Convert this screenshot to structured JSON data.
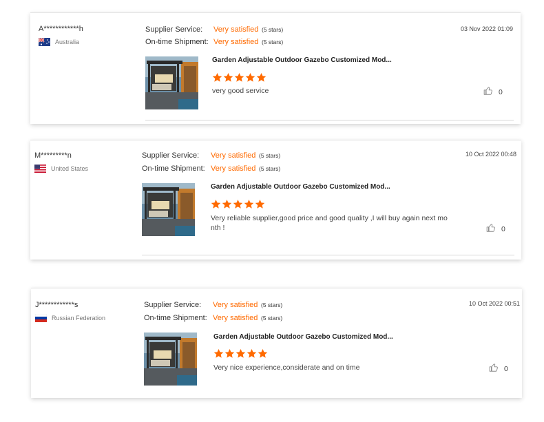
{
  "colors": {
    "accent": "#ff6a00",
    "text": "#333333",
    "muted": "#777777",
    "divider": "#d6d6d6"
  },
  "icons": {
    "like": "thumbs-up-icon",
    "star": "star-icon"
  },
  "reviews": [
    {
      "buyer": "A************h",
      "country": "Australia",
      "flag": "australia-flag-icon",
      "supplier_label": "Supplier Service:",
      "supplier_value": "Very satisfied",
      "supplier_stars": "(5 stars)",
      "shipment_label": "On-time Shipment:",
      "shipment_value": "Very satisfied",
      "shipment_stars": "(5 stars)",
      "date": "03 Nov 2022 01:09",
      "product_title": "Garden Adjustable Outdoor Gazebo Customized Mod...",
      "rating": 5,
      "comment": "very good service",
      "likes": "0"
    },
    {
      "buyer": "M*********n",
      "country": "United States",
      "flag": "united-states-flag-icon",
      "supplier_label": "Supplier Service:",
      "supplier_value": "Very satisfied",
      "supplier_stars": "(5 stars)",
      "shipment_label": "On-time Shipment:",
      "shipment_value": "Very satisfied",
      "shipment_stars": "(5 stars)",
      "date": "10 Oct 2022 00:48",
      "product_title": "Garden Adjustable Outdoor Gazebo Customized Mod...",
      "rating": 5,
      "comment": "Very reliable supplier,good price and good quality ,I will buy again next mo nth !",
      "likes": "0"
    },
    {
      "buyer": "J************s",
      "country": "Russian Federation",
      "flag": "russia-flag-icon",
      "supplier_label": "Supplier Service:",
      "supplier_value": "Very satisfied",
      "supplier_stars": "(5 stars)",
      "shipment_label": "On-time Shipment:",
      "shipment_value": "Very satisfied",
      "shipment_stars": "(5 stars)",
      "date": "10 Oct 2022 00:51",
      "product_title": "Garden Adjustable Outdoor Gazebo Customized Mod...",
      "rating": 5,
      "comment": "Very nice experience,considerate and on time",
      "likes": "0"
    }
  ]
}
